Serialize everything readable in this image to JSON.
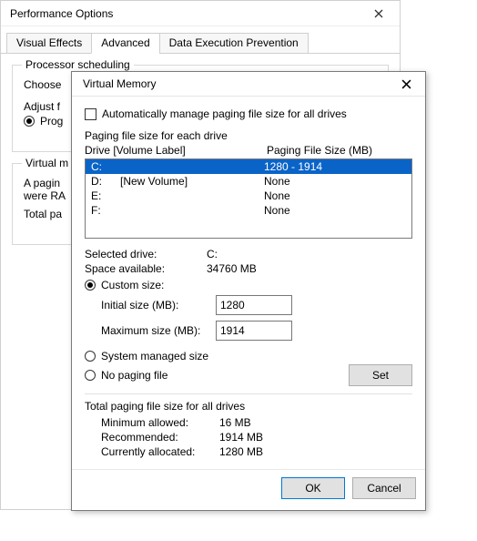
{
  "back": {
    "title": "Performance Options",
    "tabs": {
      "visual": "Visual Effects",
      "advanced": "Advanced",
      "dep": "Data Execution Prevention"
    },
    "proc_group": "Processor scheduling",
    "choose": "Choose",
    "adjust": "Adjust f",
    "programs": "Prog",
    "vm_group": "Virtual m",
    "vm_text1": "A pagin",
    "vm_text2": "were RA",
    "vm_text3": "Total pa"
  },
  "dlg": {
    "title": "Virtual Memory",
    "auto_manage": "Automatically manage paging file size for all drives",
    "list_label": "Paging file size for each drive",
    "hdr_drive": "Drive  [Volume Label]",
    "hdr_size": "Paging File Size (MB)",
    "drives": [
      {
        "d": "C:",
        "v": "",
        "s": "1280 - 1914",
        "sel": true
      },
      {
        "d": "D:",
        "v": "[New Volume]",
        "s": "None",
        "sel": false
      },
      {
        "d": "E:",
        "v": "",
        "s": "None",
        "sel": false
      },
      {
        "d": "F:",
        "v": "",
        "s": "None",
        "sel": false
      }
    ],
    "selected_drive_label": "Selected drive:",
    "selected_drive_value": "C:",
    "space_label": "Space available:",
    "space_value": "34760 MB",
    "custom_size": "Custom size:",
    "initial_label": "Initial size (MB):",
    "initial_value": "1280",
    "max_label": "Maximum size (MB):",
    "max_value": "1914",
    "system_managed": "System managed size",
    "no_paging": "No paging file",
    "set": "Set",
    "totals_header": "Total paging file size for all drives",
    "min_label": "Minimum allowed:",
    "min_value": "16 MB",
    "rec_label": "Recommended:",
    "rec_value": "1914 MB",
    "cur_label": "Currently allocated:",
    "cur_value": "1280 MB",
    "ok": "OK",
    "cancel": "Cancel"
  }
}
